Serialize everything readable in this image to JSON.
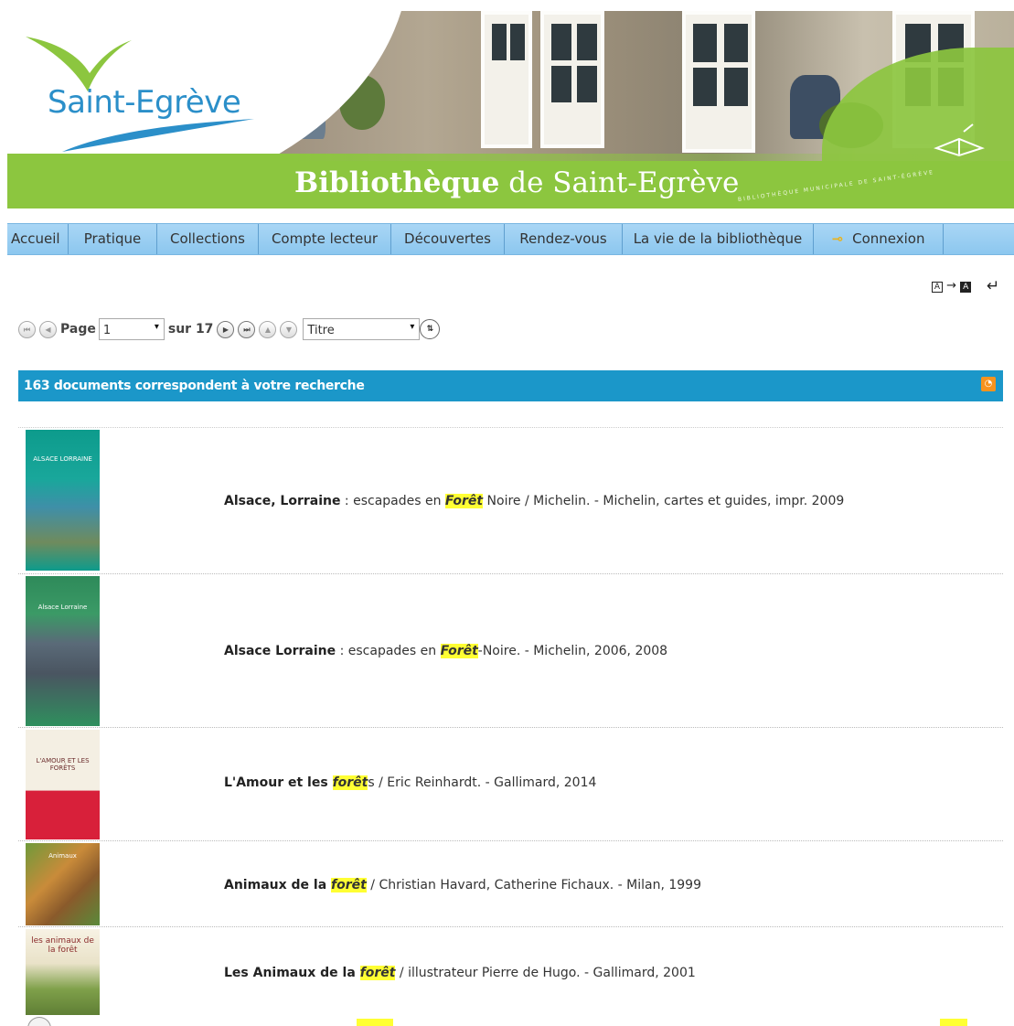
{
  "banner": {
    "logo_part1": "Saint-",
    "logo_part2": "Egrève",
    "title_bold": "Bibliothèque",
    "title_rest": " de Saint-Egrève",
    "subtitle": "BIBLIOTHÈQUE MUNICIPALE DE SAINT-ÉGRÈVE",
    "colors": {
      "green": "#8cc63f",
      "blue": "#2b8fc9"
    }
  },
  "nav": {
    "items": [
      {
        "label": "Accueil"
      },
      {
        "label": "Pratique"
      },
      {
        "label": "Collections"
      },
      {
        "label": "Compte lecteur"
      },
      {
        "label": "Découvertes"
      },
      {
        "label": "Rendez-vous"
      },
      {
        "label": "La vie de la bibliothèque"
      },
      {
        "label": "Connexion",
        "icon": "key-icon"
      }
    ]
  },
  "pager": {
    "page_label": "Page",
    "page_value": "1",
    "of_label": "sur 17",
    "sort_value": "Titre"
  },
  "results": {
    "count_text": "163 documents correspondent à votre recherche",
    "items": [
      {
        "title": "Alsace, Lorraine",
        "before": " : escapades en ",
        "highlight": "Forêt",
        "after": " Noire / Michelin. - Michelin, cartes et guides, impr. 2009",
        "cover_text": "ALSACE LORRAINE"
      },
      {
        "title": "Alsace Lorraine",
        "before": " : escapades en ",
        "highlight": "Forêt",
        "after": "-Noire. - Michelin, 2006, 2008",
        "cover_text": "Alsace Lorraine"
      },
      {
        "title": "L'Amour et les ",
        "before": "",
        "highlight": "forêt",
        "after": "s / Eric Reinhardt. - Gallimard, 2014",
        "cover_text": "L'AMOUR ET LES FORÊTS"
      },
      {
        "title": "Animaux de la ",
        "before": "",
        "highlight": "forêt",
        "after": " / Christian Havard, Catherine Fichaux. - Milan, 1999",
        "cover_text": "Animaux"
      },
      {
        "title": "Les Animaux de la ",
        "before": "",
        "highlight": "forêt",
        "after": " / illustrateur Pierre de Hugo. - Gallimard, 2001",
        "cover_text": "les animaux de la forêt"
      }
    ]
  }
}
